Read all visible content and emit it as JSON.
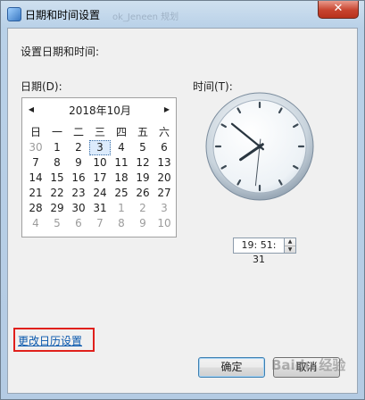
{
  "window": {
    "title": "日期和时间设置",
    "title_ghost": "ok_Jeneen 规划",
    "close_glyph": "✕"
  },
  "content": {
    "heading": "设置日期和时间:",
    "date_label": "日期(D):",
    "time_label": "时间(T):",
    "change_calendar_link": "更改日历设置"
  },
  "calendar": {
    "month_label": "2018年10月",
    "prev_icon": "◀",
    "next_icon": "▶",
    "weekdays": [
      "日",
      "一",
      "二",
      "三",
      "四",
      "五",
      "六"
    ],
    "days": [
      "30",
      "1",
      "2",
      "3",
      "4",
      "5",
      "6",
      "7",
      "8",
      "9",
      "10",
      "11",
      "12",
      "13",
      "14",
      "15",
      "16",
      "17",
      "18",
      "19",
      "20",
      "21",
      "22",
      "23",
      "24",
      "25",
      "26",
      "27",
      "28",
      "29",
      "30",
      "31",
      "1",
      "2",
      "3",
      "4",
      "5",
      "6",
      "7",
      "8",
      "9",
      "10"
    ],
    "selected_day": "3",
    "other_month_indices": [
      0,
      32,
      33,
      34,
      35,
      36,
      37,
      38,
      39,
      40,
      41
    ]
  },
  "clock": {
    "hour": 19,
    "minute": 51,
    "second": 31,
    "time_text": "19: 51: 31",
    "spin_up_glyph": "▲",
    "spin_down_glyph": "▼"
  },
  "buttons": {
    "ok": "确定",
    "cancel": "取消"
  },
  "watermark": "Baidu 经验"
}
